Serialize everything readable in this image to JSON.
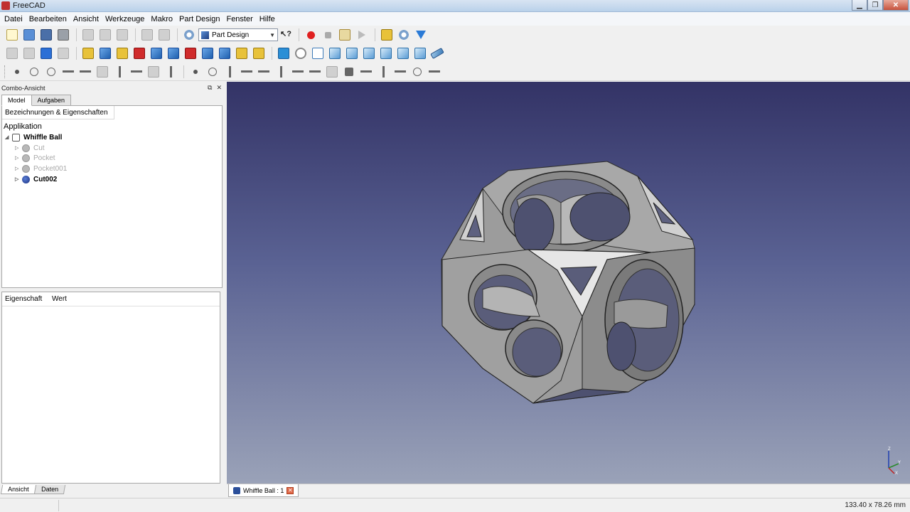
{
  "window": {
    "title": "FreeCAD",
    "controls": [
      "minimize",
      "maximize",
      "close"
    ]
  },
  "menubar": [
    "Datei",
    "Bearbeiten",
    "Ansicht",
    "Werkzeuge",
    "Makro",
    "Part Design",
    "Fenster",
    "Hilfe"
  ],
  "toolbar": {
    "workbench": "Part Design"
  },
  "combo": {
    "title": "Combo-Ansicht",
    "tabs": [
      "Model",
      "Aufgaben"
    ],
    "tree_header": "Bezeichnungen & Eigenschaften",
    "app_label": "Applikation",
    "document": "Whiffle Ball",
    "items": [
      {
        "label": "Cut",
        "state": "hidden"
      },
      {
        "label": "Pocket",
        "state": "hidden"
      },
      {
        "label": "Pocket001",
        "state": "hidden"
      },
      {
        "label": "Cut002",
        "state": "visible"
      }
    ],
    "prop_headers": [
      "Eigenschaft",
      "Wert"
    ],
    "bottom_tabs": [
      "Ansicht",
      "Daten"
    ]
  },
  "viewport": {
    "tab_label": "Whiffle Ball : 1",
    "axes": [
      "X",
      "Y",
      "Z"
    ]
  },
  "status": {
    "dimensions": "133.40 x 78.26 mm"
  }
}
